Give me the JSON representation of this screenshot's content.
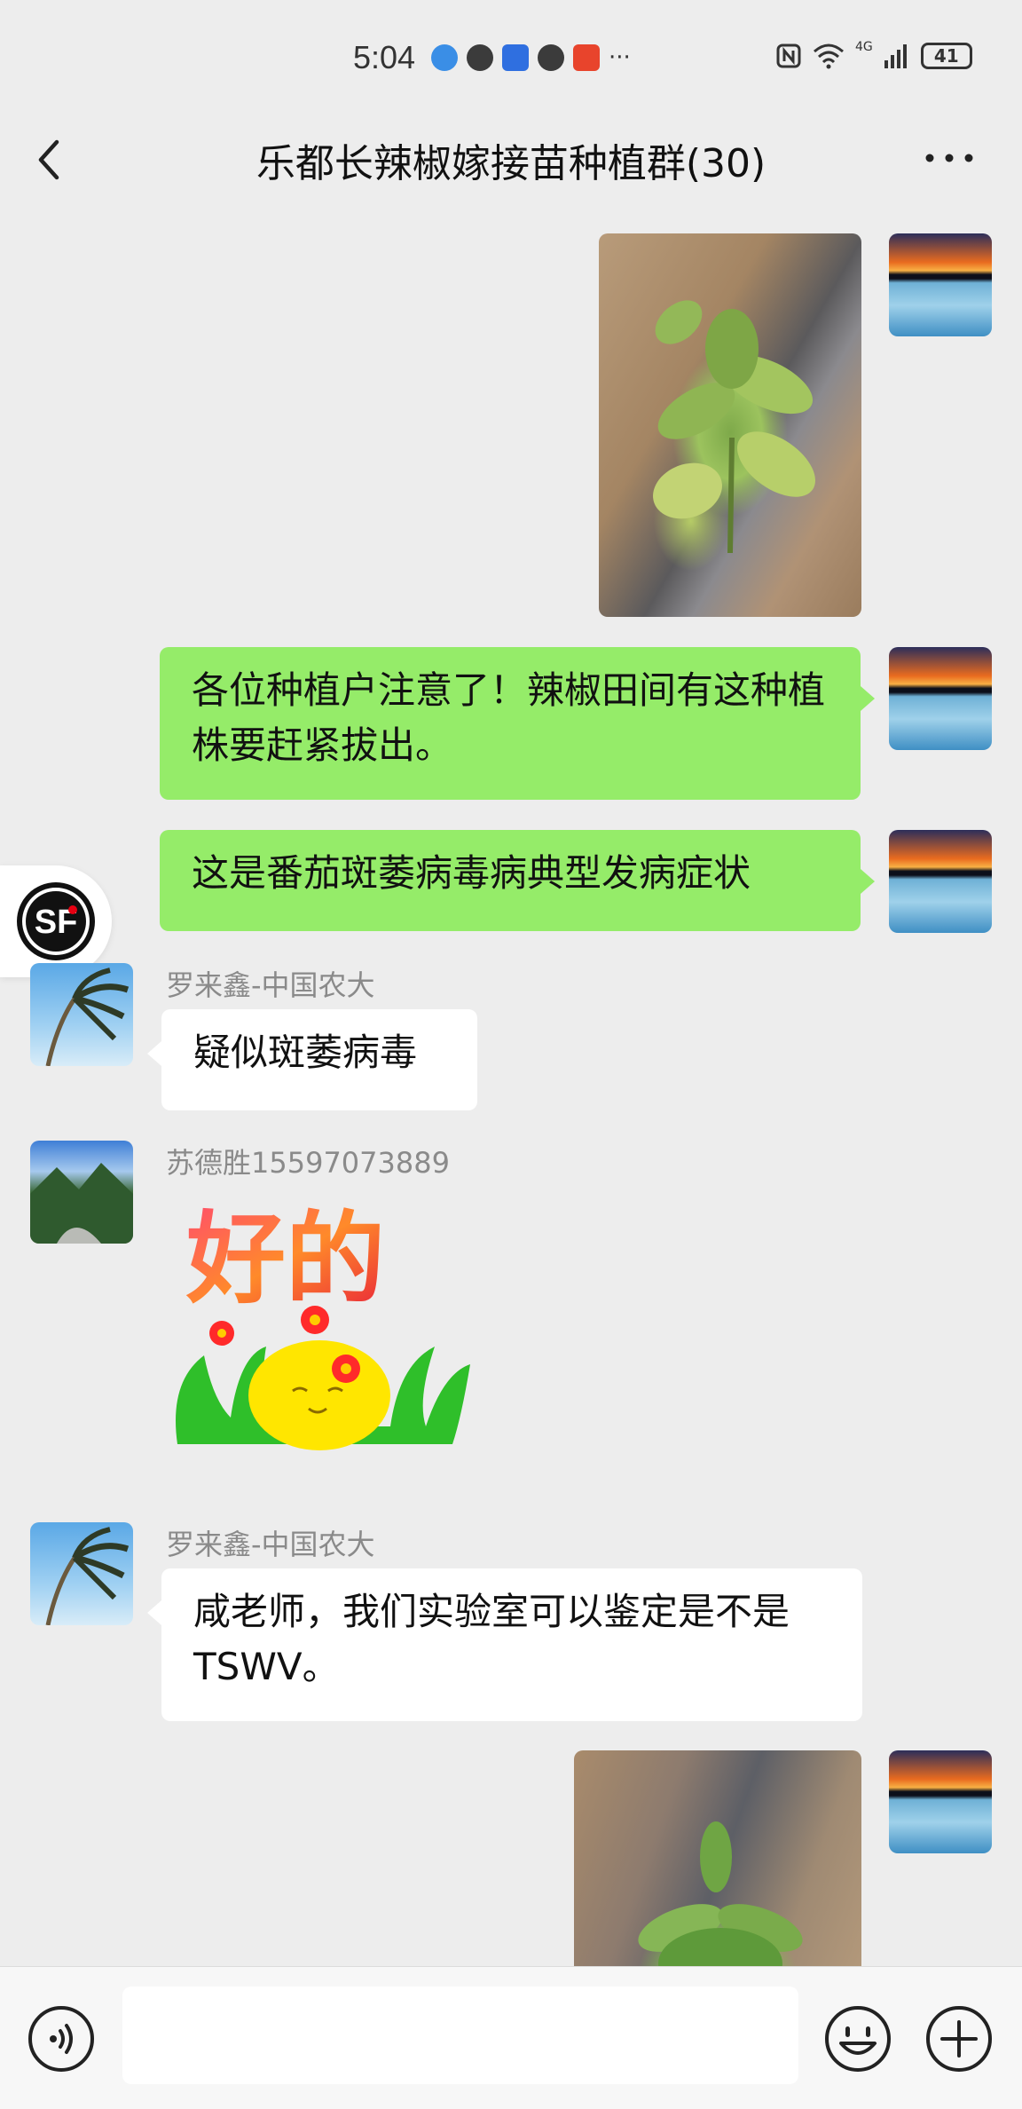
{
  "status_bar": {
    "time": "5:04",
    "more": "···",
    "battery": "41",
    "network": "4G"
  },
  "header": {
    "title": "乐都长辣椒嫁接苗种植群(30)"
  },
  "messages": [
    {
      "type": "image",
      "side": "right",
      "content": "pepper-plant-photo"
    },
    {
      "type": "text",
      "side": "right",
      "text": "各位种植户注意了！辣椒田间有这种植株要赶紧拔出。"
    },
    {
      "type": "text",
      "side": "right",
      "text": "这是番茄斑萎病毒病典型发病症状"
    },
    {
      "type": "text",
      "side": "left",
      "sender": "罗来鑫-中国农大",
      "text": "疑似斑萎病毒"
    },
    {
      "type": "sticker",
      "side": "left",
      "sender": "苏德胜15597073889",
      "text": "好的"
    },
    {
      "type": "text",
      "side": "left",
      "sender": "罗来鑫-中国农大",
      "text": "咸老师，我们实验室可以鉴定是不是 TSWV。"
    },
    {
      "type": "image",
      "side": "right",
      "content": "pepper-plant-photo-2"
    }
  ],
  "floating_widget": {
    "label": "SF"
  },
  "colors": {
    "green_bubble": "#95ec69",
    "white_bubble": "#ffffff",
    "background": "#ededed"
  }
}
